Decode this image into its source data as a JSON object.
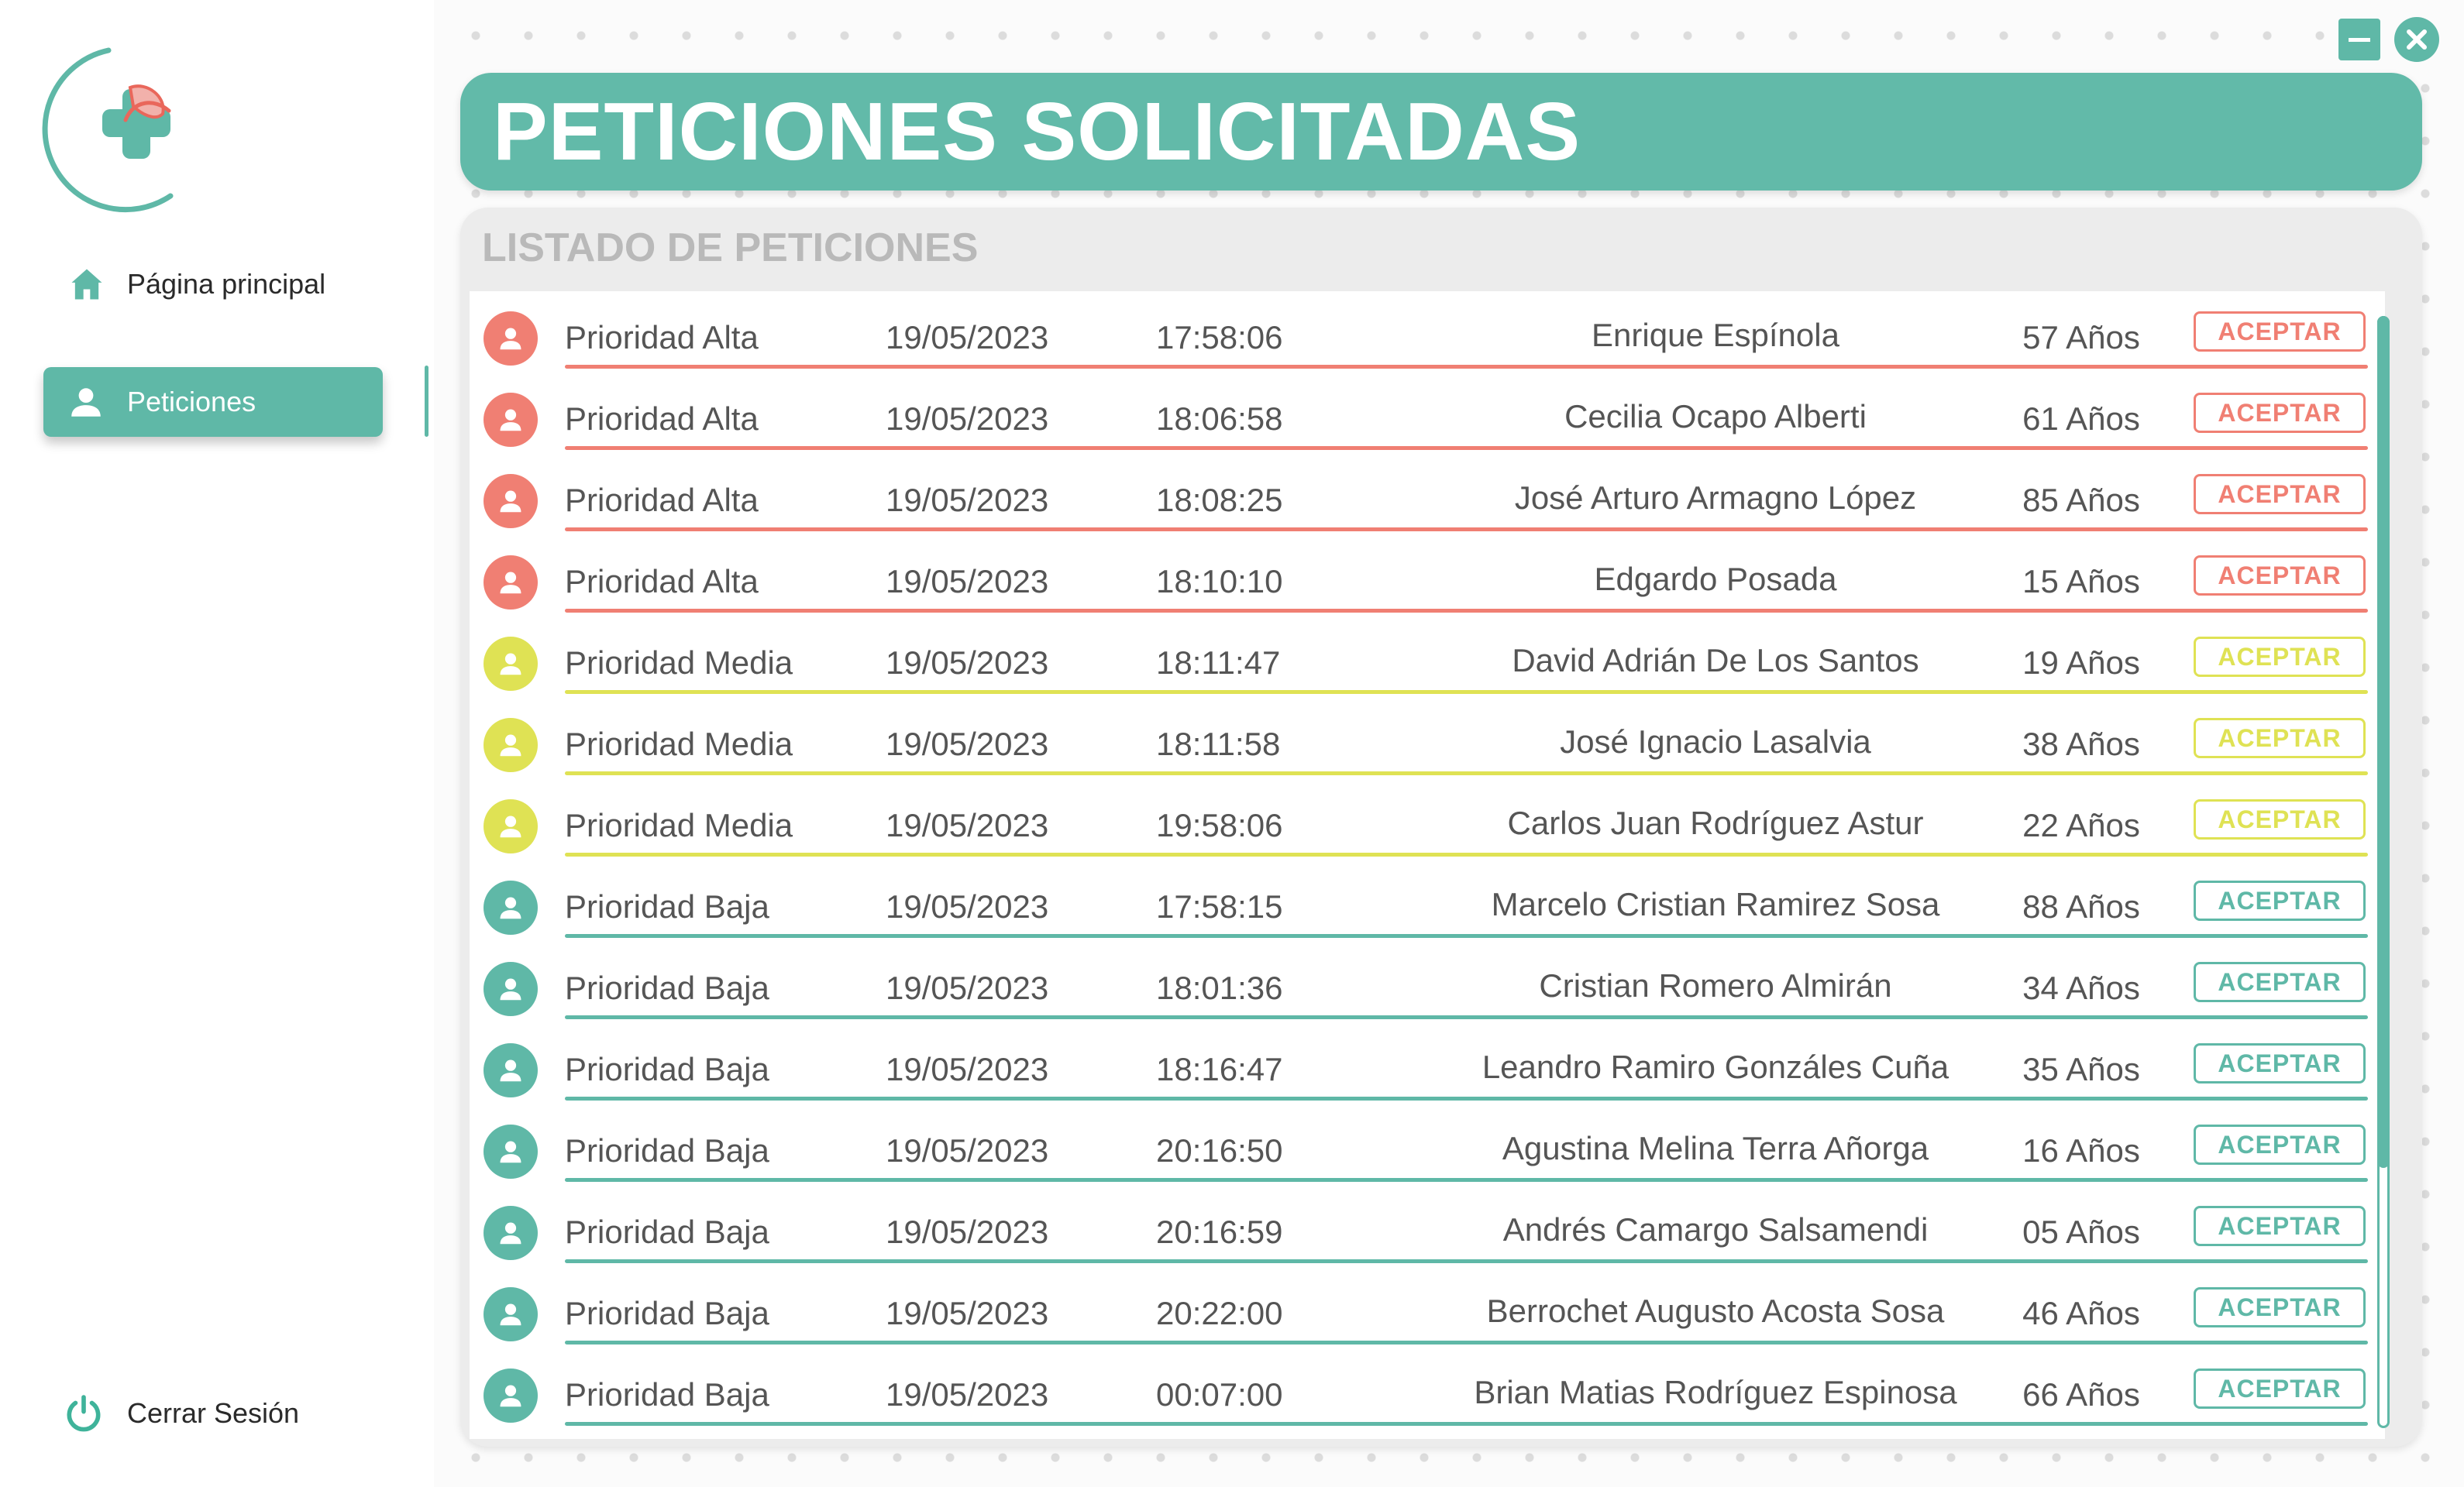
{
  "colors": {
    "accent": "#5fb8a7",
    "priority_high": "#f07f73",
    "priority_medium": "#dfe254",
    "priority_low": "#5fb8a7"
  },
  "sidebar": {
    "logo_icon": "medical-cross-logo-icon",
    "items": [
      {
        "label": "Página principal",
        "icon": "home-icon"
      },
      {
        "label": "Peticiones",
        "icon": "user-icon"
      }
    ],
    "logout": {
      "label": "Cerrar Sesión",
      "icon": "power-icon"
    }
  },
  "window": {
    "minimize_icon": "minimize-icon",
    "close_icon": "close-icon"
  },
  "main": {
    "title": "PETICIONES SOLICITADAS",
    "list_header": "LISTADO DE PETICIONES",
    "accept_label": "ACEPTAR",
    "rows": [
      {
        "priority": "Prioridad Alta",
        "level": "high",
        "date": "19/05/2023",
        "time": "17:58:06",
        "name": "Enrique Espínola",
        "age": "57 Años"
      },
      {
        "priority": "Prioridad Alta",
        "level": "high",
        "date": "19/05/2023",
        "time": "18:06:58",
        "name": "Cecilia Ocapo Alberti",
        "age": "61 Años"
      },
      {
        "priority": "Prioridad Alta",
        "level": "high",
        "date": "19/05/2023",
        "time": "18:08:25",
        "name": "José Arturo Armagno López",
        "age": "85 Años"
      },
      {
        "priority": "Prioridad Alta",
        "level": "high",
        "date": "19/05/2023",
        "time": "18:10:10",
        "name": "Edgardo Posada",
        "age": "15 Años"
      },
      {
        "priority": "Prioridad Media",
        "level": "medium",
        "date": "19/05/2023",
        "time": "18:11:47",
        "name": "David Adrián De Los Santos",
        "age": "19 Años"
      },
      {
        "priority": "Prioridad Media",
        "level": "medium",
        "date": "19/05/2023",
        "time": "18:11:58",
        "name": "José Ignacio Lasalvia",
        "age": "38 Años"
      },
      {
        "priority": "Prioridad Media",
        "level": "medium",
        "date": "19/05/2023",
        "time": "19:58:06",
        "name": "Carlos Juan Rodríguez Astur",
        "age": "22 Años"
      },
      {
        "priority": "Prioridad Baja",
        "level": "low",
        "date": "19/05/2023",
        "time": "17:58:15",
        "name": "Marcelo Cristian Ramirez Sosa",
        "age": "88 Años"
      },
      {
        "priority": "Prioridad Baja",
        "level": "low",
        "date": "19/05/2023",
        "time": "18:01:36",
        "name": "Cristian Romero Almirán",
        "age": "34 Años"
      },
      {
        "priority": "Prioridad Baja",
        "level": "low",
        "date": "19/05/2023",
        "time": "18:16:47",
        "name": "Leandro Ramiro Gonzáles Cuña",
        "age": "35 Años"
      },
      {
        "priority": "Prioridad Baja",
        "level": "low",
        "date": "19/05/2023",
        "time": "20:16:50",
        "name": "Agustina Melina Terra Añorga",
        "age": "16 Años"
      },
      {
        "priority": "Prioridad Baja",
        "level": "low",
        "date": "19/05/2023",
        "time": "20:16:59",
        "name": "Andrés Camargo Salsamendi",
        "age": "05 Años"
      },
      {
        "priority": "Prioridad Baja",
        "level": "low",
        "date": "19/05/2023",
        "time": "20:22:00",
        "name": "Berrochet Augusto Acosta Sosa",
        "age": "46 Años"
      },
      {
        "priority": "Prioridad Baja",
        "level": "low",
        "date": "19/05/2023",
        "time": "00:07:00",
        "name": "Brian Matias Rodríguez Espinosa",
        "age": "66 Años"
      }
    ]
  }
}
